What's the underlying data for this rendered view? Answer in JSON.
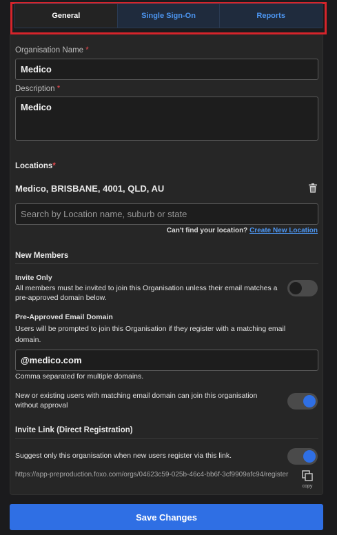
{
  "tabs": [
    {
      "label": "General",
      "active": true
    },
    {
      "label": "Single Sign-On",
      "active": false
    },
    {
      "label": "Reports",
      "active": false
    }
  ],
  "form": {
    "org_name_label": "Organisation Name",
    "org_name_value": "Medico",
    "description_label": "Description",
    "description_value": "Medico",
    "required_mark": "*"
  },
  "locations": {
    "title": "Locations",
    "items": [
      "Medico, BRISBANE, 4001, QLD, AU"
    ],
    "search_placeholder": "Search by Location name, suburb or state",
    "cant_find_text": "Can't find your location?",
    "create_link": "Create New Location"
  },
  "new_members": {
    "title": "New Members",
    "invite_only_title": "Invite Only",
    "invite_only_desc": "All members must be invited to join this Organisation unless their email matches a pre-approved domain below.",
    "invite_only_on": false,
    "domain_title": "Pre-Approved Email Domain",
    "domain_desc": "Users will be prompted to join this Organisation if they register with a matching email domain.",
    "domain_value": "@medico.com",
    "domain_hint": "Comma separated for multiple domains.",
    "auto_join_desc": "New or existing users with matching email domain can join this organisation without approval",
    "auto_join_on": true
  },
  "invite_link": {
    "title": "Invite Link (Direct Registration)",
    "suggest_desc": "Suggest only this organisation when new users register via this link.",
    "suggest_on": true,
    "url": "https://app-preproduction.foxo.com/orgs/04623c59-025b-46c4-bb6f-3cf9909afc94/register",
    "copy_label": "copy"
  },
  "save_label": "Save Changes",
  "colors": {
    "accent": "#2f6fe4",
    "link": "#4c95f0",
    "required": "#e5484d",
    "highlight": "#d6242b"
  }
}
